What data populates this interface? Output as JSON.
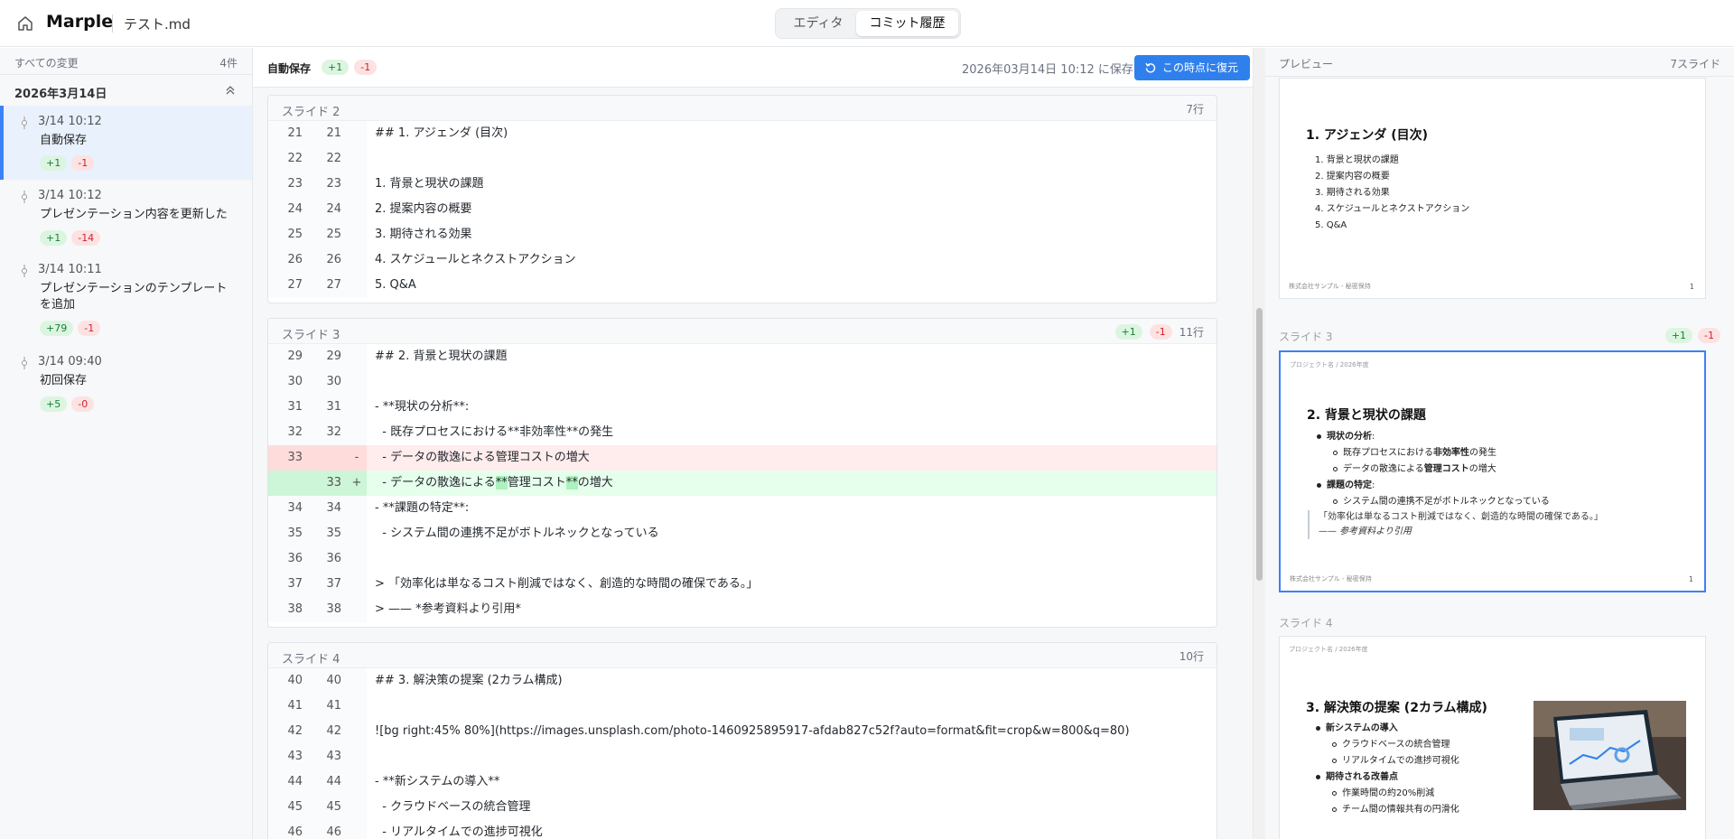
{
  "header": {
    "app_name": "Marple",
    "file_name": "テスト.md",
    "tab_editor": "エディタ",
    "tab_history": "コミット履歴"
  },
  "sidebar": {
    "title": "すべての変更",
    "count": "4件",
    "date_group": "2026年3月14日",
    "commits": [
      {
        "time": "3/14 10:12",
        "message": "自動保存",
        "add": "+1",
        "del": "-1"
      },
      {
        "time": "3/14 10:12",
        "message": "プレゼンテーション内容を更新した",
        "add": "+1",
        "del": "-14"
      },
      {
        "time": "3/14 10:11",
        "message": "プレゼンテーションのテンプレートを追加",
        "add": "+79",
        "del": "-1"
      },
      {
        "time": "3/14 09:40",
        "message": "初回保存",
        "add": "+5",
        "del": "-0"
      }
    ]
  },
  "toolbar": {
    "label": "自動保存",
    "add": "+1",
    "del": "-1",
    "saved_at": "2026年03月14日 10:12 に保存",
    "restore": "この時点に復元"
  },
  "diff": {
    "slide2": {
      "title": "スライド 2",
      "lines_count": "7行",
      "rows": [
        {
          "old": "21",
          "new": "21",
          "sign": "",
          "code": "## 1. アジェンダ (目次)"
        },
        {
          "old": "22",
          "new": "22",
          "sign": "",
          "code": ""
        },
        {
          "old": "23",
          "new": "23",
          "sign": "",
          "code": "1. 背景と現状の課題"
        },
        {
          "old": "24",
          "new": "24",
          "sign": "",
          "code": "2. 提案内容の概要"
        },
        {
          "old": "25",
          "new": "25",
          "sign": "",
          "code": "3. 期待される効果"
        },
        {
          "old": "26",
          "new": "26",
          "sign": "",
          "code": "4. スケジュールとネクストアクション"
        },
        {
          "old": "27",
          "new": "27",
          "sign": "",
          "code": "5. Q&A"
        }
      ]
    },
    "slide3": {
      "title": "スライド 3",
      "add": "+1",
      "del": "-1",
      "lines_count": "11行",
      "rows": [
        {
          "old": "29",
          "new": "29",
          "sign": "",
          "code": "## 2. 背景と現状の課題"
        },
        {
          "old": "30",
          "new": "30",
          "sign": "",
          "code": ""
        },
        {
          "old": "31",
          "new": "31",
          "sign": "",
          "code": "- **現状の分析**:"
        },
        {
          "old": "32",
          "new": "32",
          "sign": "",
          "code": "  - 既存プロセスにおける**非効率性**の発生"
        },
        {
          "old": "33",
          "new": "",
          "sign": "-",
          "code": "  - データの散逸による管理コストの増大"
        },
        {
          "old": "",
          "new": "33",
          "sign": "+",
          "code_a": "  - データの散逸による",
          "code_b": "**",
          "code_c": "管理コスト",
          "code_d": "**",
          "code_e": "の増大"
        },
        {
          "old": "34",
          "new": "34",
          "sign": "",
          "code": "- **課題の特定**:"
        },
        {
          "old": "35",
          "new": "35",
          "sign": "",
          "code": "  - システム間の連携不足がボトルネックとなっている"
        },
        {
          "old": "36",
          "new": "36",
          "sign": "",
          "code": ""
        },
        {
          "old": "37",
          "new": "37",
          "sign": "",
          "code": "> 「効率化は単なるコスト削減ではなく、創造的な時間の確保である。」"
        },
        {
          "old": "38",
          "new": "38",
          "sign": "",
          "code": "> —— *参考資料より引用*"
        }
      ]
    },
    "slide4": {
      "title": "スライド 4",
      "lines_count": "10行",
      "rows": [
        {
          "old": "40",
          "new": "40",
          "sign": "",
          "code": "## 3. 解決策の提案 (2カラム構成)"
        },
        {
          "old": "41",
          "new": "41",
          "sign": "",
          "code": ""
        },
        {
          "old": "42",
          "new": "42",
          "sign": "",
          "code": "![bg right:45% 80%](https://images.unsplash.com/photo-1460925895917-afdab827c52f?auto=format&fit=crop&w=800&q=80)"
        },
        {
          "old": "43",
          "new": "43",
          "sign": "",
          "code": ""
        },
        {
          "old": "44",
          "new": "44",
          "sign": "",
          "code": "- **新システムの導入**"
        },
        {
          "old": "45",
          "new": "45",
          "sign": "",
          "code": "  - クラウドベースの統合管理"
        },
        {
          "old": "46",
          "new": "46",
          "sign": "",
          "code": "  - リアルタイムでの進捗可視化"
        }
      ]
    }
  },
  "preview": {
    "title": "プレビュー",
    "count": "7スライド",
    "slide2": {
      "title": "1. アジェンダ (目次)",
      "items": [
        "1. 背景と現状の課題",
        "2. 提案内容の概要",
        "3. 期待される効果",
        "4. スケジュールとネクストアクション",
        "5. Q&A"
      ],
      "footer": "株式会社サンプル - 秘密保持",
      "num": "1"
    },
    "slide3": {
      "label": "スライド 3",
      "add": "+1",
      "del": "-1",
      "header": "プロジェクト名 / 2026年度",
      "title": "2. 背景と現状の課題",
      "b1_bold": "現状の分析",
      "b1_rest": ":",
      "s1a_pre": "既存プロセスにおける",
      "s1a_bold": "非効率性",
      "s1a_post": "の発生",
      "s1b_pre": "データの散逸による",
      "s1b_bold": "管理コスト",
      "s1b_post": "の増大",
      "b2_bold": "課題の特定",
      "b2_rest": ":",
      "s2a": "システム間の連携不足がボトルネックとなっている",
      "quote1": "「効率化は単なるコスト削減ではなく、創造的な時間の確保である。」",
      "quote2_pre": "—— ",
      "quote2_em": "参考資料より引用",
      "footer": "株式会社サンプル - 秘密保持",
      "num": "1"
    },
    "slide4": {
      "label": "スライド 4",
      "header": "プロジェクト名 / 2026年度",
      "title": "3. 解決策の提案 (2カラム構成)",
      "b1": "新システムの導入",
      "s1a": "クラウドベースの統合管理",
      "s1b": "リアルタイムでの進捗可視化",
      "b2": "期待される改善点",
      "s2a": "作業時間の約20%削減",
      "s2b": "チーム間の情報共有の円滑化"
    }
  }
}
